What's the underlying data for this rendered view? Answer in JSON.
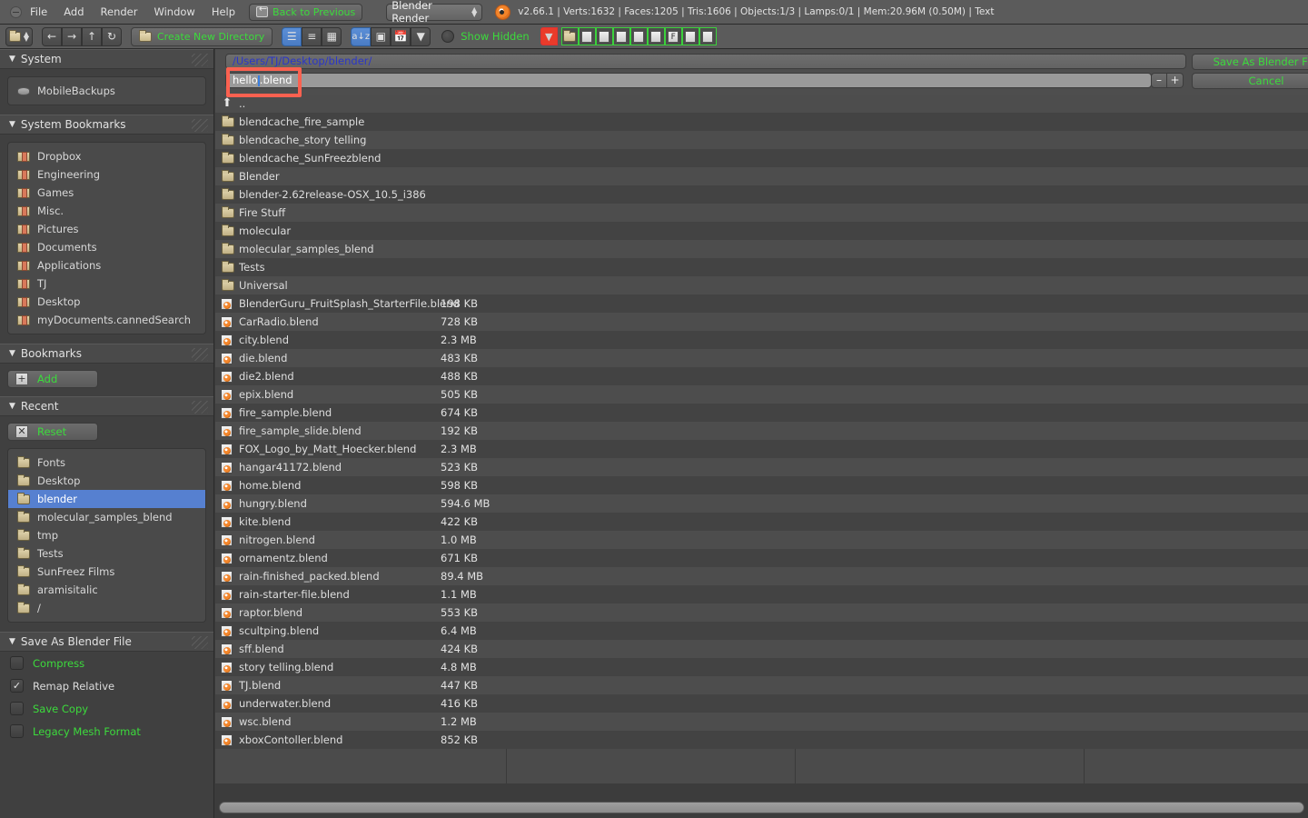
{
  "window": {
    "menus": [
      "File",
      "Add",
      "Render",
      "Window",
      "Help"
    ],
    "back_button": "Back to Previous",
    "render_engine": "Blender Render",
    "status": "v2.66.1 | Verts:1632 | Faces:1205 | Tris:1606 | Objects:1/3 | Lamps:0/1 | Mem:20.96M (0.50M) | Text"
  },
  "toolbar": {
    "editor_type_icon": "file-browser-icon",
    "nav_back_icon": "arrow-left-icon",
    "nav_forward_icon": "arrow-right-icon",
    "nav_parent_icon": "arrow-up-icon",
    "nav_refresh_icon": "refresh-icon",
    "create_new_directory": "Create New Directory",
    "display_modes": [
      {
        "name": "display-short-list",
        "icon": "short-list-icon",
        "active": true
      },
      {
        "name": "display-long-list",
        "icon": "long-list-icon",
        "active": false
      },
      {
        "name": "display-thumbnails",
        "icon": "thumbnail-grid-icon",
        "active": false
      }
    ],
    "sort_modes": [
      {
        "name": "sort-alphabetical",
        "icon": "a-z-icon",
        "active": true
      },
      {
        "name": "sort-extension",
        "icon": "file-extension-icon",
        "active": false
      },
      {
        "name": "sort-date",
        "icon": "calendar-icon",
        "active": false
      },
      {
        "name": "sort-size",
        "icon": "size-filter-icon",
        "active": false
      }
    ],
    "show_hidden_label": "Show Hidden",
    "show_hidden_checked": false,
    "filters": [
      {
        "name": "filter-toggle",
        "icon": "funnel-icon",
        "color": "#ea3b2a"
      },
      {
        "name": "filter-folders",
        "icon": "folder-icon"
      },
      {
        "name": "filter-blend-files",
        "icon": "blend-file-icon"
      },
      {
        "name": "filter-blend-link",
        "icon": "blend-link-icon"
      },
      {
        "name": "filter-images",
        "icon": "image-icon"
      },
      {
        "name": "filter-movies",
        "icon": "movie-icon"
      },
      {
        "name": "filter-scripts",
        "icon": "script-icon"
      },
      {
        "name": "filter-fonts",
        "icon": "font-f-icon"
      },
      {
        "name": "filter-sounds",
        "icon": "sound-note-icon"
      },
      {
        "name": "filter-text",
        "icon": "text-document-icon"
      }
    ]
  },
  "path": {
    "directory": "/Users/TJ/Desktop/blender/",
    "filename_prefix": "hello",
    "filename_suffix": ".blend",
    "filename_full": "hello.blend",
    "decrement_label": "–",
    "increment_label": "+"
  },
  "actions": {
    "confirm": "Save As Blender File",
    "cancel": "Cancel"
  },
  "sidebar": {
    "system": {
      "title": "System",
      "items": [
        {
          "label": "MobileBackups",
          "icon": "disk-icon"
        }
      ]
    },
    "system_bookmarks": {
      "title": "System Bookmarks",
      "items": [
        {
          "label": "Dropbox",
          "icon": "bookmark-folder-icon"
        },
        {
          "label": "Engineering",
          "icon": "bookmark-folder-icon"
        },
        {
          "label": "Games",
          "icon": "bookmark-folder-icon"
        },
        {
          "label": "Misc.",
          "icon": "bookmark-folder-icon"
        },
        {
          "label": "Pictures",
          "icon": "bookmark-folder-icon"
        },
        {
          "label": "Documents",
          "icon": "bookmark-folder-icon"
        },
        {
          "label": "Applications",
          "icon": "bookmark-folder-icon"
        },
        {
          "label": "TJ",
          "icon": "bookmark-folder-icon"
        },
        {
          "label": "Desktop",
          "icon": "bookmark-folder-icon"
        },
        {
          "label": "myDocuments.cannedSearch",
          "icon": "bookmark-folder-icon"
        }
      ]
    },
    "bookmarks": {
      "title": "Bookmarks",
      "add_label": "Add"
    },
    "recent": {
      "title": "Recent",
      "reset_label": "Reset",
      "items": [
        {
          "label": "Fonts",
          "selected": false
        },
        {
          "label": "Desktop",
          "selected": false
        },
        {
          "label": "blender",
          "selected": true
        },
        {
          "label": "molecular_samples_blend",
          "selected": false
        },
        {
          "label": "tmp",
          "selected": false
        },
        {
          "label": "Tests",
          "selected": false
        },
        {
          "label": "SunFreez Films",
          "selected": false
        },
        {
          "label": "aramisitalic",
          "selected": false
        },
        {
          "label": "/",
          "selected": false
        }
      ]
    },
    "save_options": {
      "title": "Save As Blender File",
      "options": [
        {
          "label": "Compress",
          "checked": false,
          "green": true
        },
        {
          "label": "Remap Relative",
          "checked": true,
          "green": false
        },
        {
          "label": "Save Copy",
          "checked": false,
          "green": true
        },
        {
          "label": "Legacy Mesh Format",
          "checked": false,
          "green": true
        }
      ]
    }
  },
  "files": [
    {
      "name": "..",
      "size": "",
      "type": "parent"
    },
    {
      "name": "blendcache_fire_sample",
      "size": "",
      "type": "folder"
    },
    {
      "name": "blendcache_story telling",
      "size": "",
      "type": "folder"
    },
    {
      "name": "blendcache_SunFreezblend",
      "size": "",
      "type": "folder"
    },
    {
      "name": "Blender",
      "size": "",
      "type": "folder"
    },
    {
      "name": "blender-2.62release-OSX_10.5_i386",
      "size": "",
      "type": "folder"
    },
    {
      "name": "Fire Stuff",
      "size": "",
      "type": "folder"
    },
    {
      "name": "molecular",
      "size": "",
      "type": "folder"
    },
    {
      "name": "molecular_samples_blend",
      "size": "",
      "type": "folder"
    },
    {
      "name": "Tests",
      "size": "",
      "type": "folder"
    },
    {
      "name": "Universal",
      "size": "",
      "type": "folder"
    },
    {
      "name": "BlenderGuru_FruitSplash_StarterFile.blend",
      "size": "198 KB",
      "type": "blend"
    },
    {
      "name": "CarRadio.blend",
      "size": "728 KB",
      "type": "blend"
    },
    {
      "name": "city.blend",
      "size": "2.3 MB",
      "type": "blend"
    },
    {
      "name": "die.blend",
      "size": "483 KB",
      "type": "blend"
    },
    {
      "name": "die2.blend",
      "size": "488 KB",
      "type": "blend"
    },
    {
      "name": "epix.blend",
      "size": "505 KB",
      "type": "blend"
    },
    {
      "name": "fire_sample.blend",
      "size": "674 KB",
      "type": "blend"
    },
    {
      "name": "fire_sample_slide.blend",
      "size": "192 KB",
      "type": "blend"
    },
    {
      "name": "FOX_Logo_by_Matt_Hoecker.blend",
      "size": "2.3 MB",
      "type": "blend"
    },
    {
      "name": "hangar41172.blend",
      "size": "523 KB",
      "type": "blend"
    },
    {
      "name": "home.blend",
      "size": "598 KB",
      "type": "blend"
    },
    {
      "name": "hungry.blend",
      "size": "594.6 MB",
      "type": "blend"
    },
    {
      "name": "kite.blend",
      "size": "422 KB",
      "type": "blend"
    },
    {
      "name": "nitrogen.blend",
      "size": "1.0 MB",
      "type": "blend"
    },
    {
      "name": "ornamentz.blend",
      "size": "671 KB",
      "type": "blend"
    },
    {
      "name": "rain-finished_packed.blend",
      "size": "89.4 MB",
      "type": "blend"
    },
    {
      "name": "rain-starter-file.blend",
      "size": "1.1 MB",
      "type": "blend"
    },
    {
      "name": "raptor.blend",
      "size": "553 KB",
      "type": "blend"
    },
    {
      "name": "scultping.blend",
      "size": "6.4 MB",
      "type": "blend"
    },
    {
      "name": "sff.blend",
      "size": "424 KB",
      "type": "blend"
    },
    {
      "name": "story telling.blend",
      "size": "4.8 MB",
      "type": "blend"
    },
    {
      "name": "TJ.blend",
      "size": "447 KB",
      "type": "blend"
    },
    {
      "name": "underwater.blend",
      "size": "416 KB",
      "type": "blend"
    },
    {
      "name": "wsc.blend",
      "size": "1.2 MB",
      "type": "blend"
    },
    {
      "name": "xboxContoller.blend",
      "size": "852 KB",
      "type": "blend"
    }
  ],
  "colors": {
    "annotation_red": "#fb6150",
    "accent_green": "#3cdb3c",
    "selection_blue": "#5680d0",
    "path_blue": "#2a36c8"
  }
}
